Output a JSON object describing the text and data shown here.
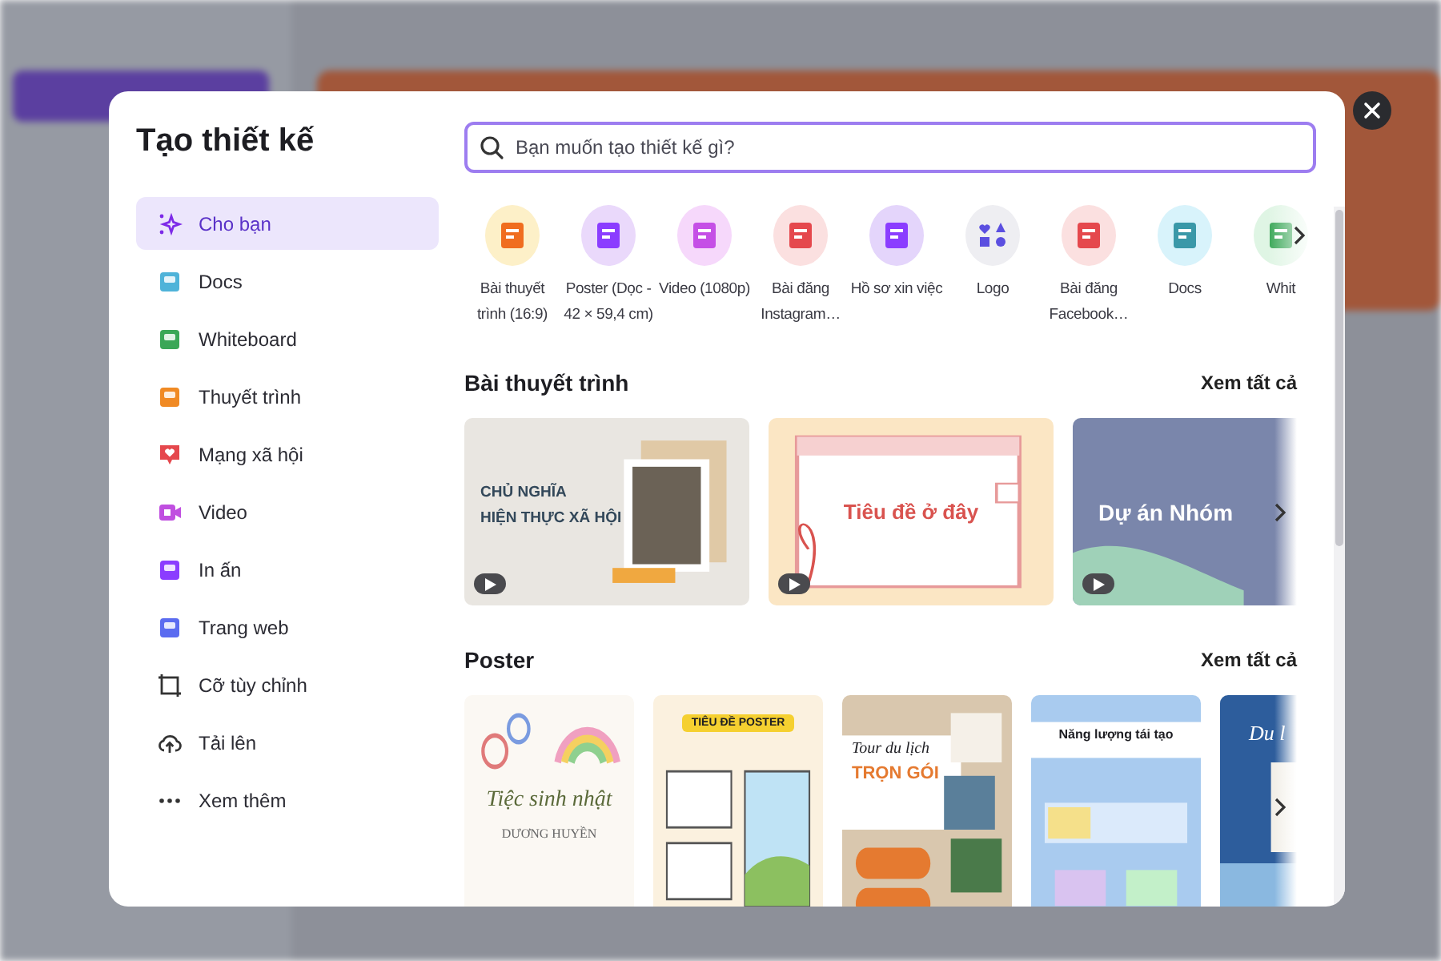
{
  "dialog": {
    "title": "Tạo thiết kế"
  },
  "search": {
    "placeholder": "Bạn muốn tạo thiết kế gì?"
  },
  "sidebar": {
    "items": [
      {
        "label": "Cho bạn",
        "kind": "sparkle",
        "selected": true
      },
      {
        "label": "Docs",
        "kind": "docs",
        "selected": false
      },
      {
        "label": "Whiteboard",
        "kind": "whiteboard",
        "selected": false
      },
      {
        "label": "Thuyết trình",
        "kind": "presentation",
        "selected": false
      },
      {
        "label": "Mạng xã hội",
        "kind": "social",
        "selected": false
      },
      {
        "label": "Video",
        "kind": "video",
        "selected": false
      },
      {
        "label": "In ấn",
        "kind": "print",
        "selected": false
      },
      {
        "label": "Trang web",
        "kind": "web",
        "selected": false
      },
      {
        "label": "Cỡ tùy chỉnh",
        "kind": "custom",
        "selected": false
      },
      {
        "label": "Tải lên",
        "kind": "upload",
        "selected": false
      },
      {
        "label": "Xem thêm",
        "kind": "more",
        "selected": false
      }
    ]
  },
  "quick_create": [
    {
      "label": "Bài thuyết trình (16:9)",
      "kind": "presentation"
    },
    {
      "label": "Poster (Dọc - 42 × 59,4 cm)",
      "kind": "poster"
    },
    {
      "label": "Video (1080p)",
      "kind": "video"
    },
    {
      "label": "Bài đăng Instagram…",
      "kind": "instagram"
    },
    {
      "label": "Hồ sơ xin việc",
      "kind": "resume"
    },
    {
      "label": "Logo",
      "kind": "logo"
    },
    {
      "label": "Bài đăng Facebook…",
      "kind": "facebook"
    },
    {
      "label": "Docs",
      "kind": "docs"
    },
    {
      "label": "Whit",
      "kind": "whiteboard"
    }
  ],
  "sections": [
    {
      "title": "Bài thuyết trình",
      "see_all": "Xem tất cả",
      "kind": "wide",
      "cards": [
        {
          "kind": "history",
          "lines": [
            "CHỦ NGHĨA",
            "HIỆN THỰC XÃ HỘI"
          ]
        },
        {
          "kind": "browser",
          "lines": [
            "Tiêu đề ở đây"
          ]
        },
        {
          "kind": "blue",
          "lines": [
            "Dự án Nhóm"
          ]
        }
      ]
    },
    {
      "title": "Poster",
      "see_all": "Xem tất cả",
      "kind": "tall",
      "cards": [
        {
          "kind": "birthday",
          "lines": [
            "Tiệc sinh nhật",
            "DƯƠNG HUYỀN"
          ]
        },
        {
          "kind": "poster",
          "lines": [
            "TIÊU ĐỀ POSTER"
          ]
        },
        {
          "kind": "tour",
          "lines": [
            "Tour du lịch",
            "TRỌN GÓI"
          ]
        },
        {
          "kind": "energy",
          "lines": [
            "Năng lượng tái tạo"
          ]
        },
        {
          "kind": "travel",
          "lines": [
            "Du l"
          ]
        }
      ]
    }
  ]
}
